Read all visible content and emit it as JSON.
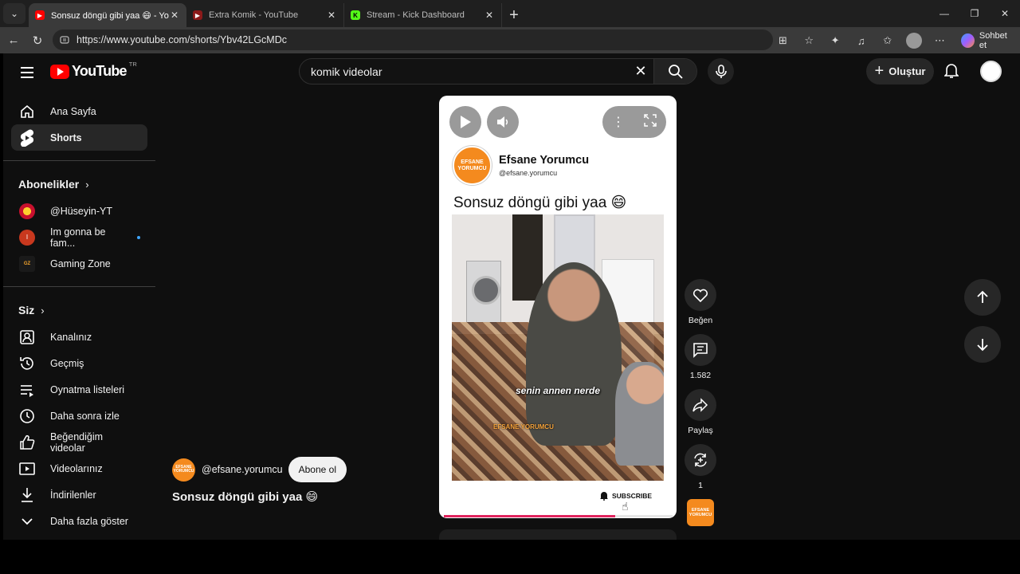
{
  "browser": {
    "tabs": [
      {
        "title": "Sonsuz döngü gibi yaa 😄 - YouTube",
        "active": true
      },
      {
        "title": "Extra Komik - YouTube",
        "active": false
      },
      {
        "title": "Stream - Kick Dashboard",
        "active": false
      }
    ],
    "url": "https://www.youtube.com/shorts/Ybv42LGcMDc",
    "chat_label": "Sohbet et"
  },
  "header": {
    "logo_text": "YouTube",
    "country_code": "TR",
    "search_value": "komik videolar",
    "create_label": "Oluştur"
  },
  "sidebar": {
    "main": [
      {
        "label": "Ana Sayfa",
        "icon": "home-icon"
      },
      {
        "label": "Shorts",
        "icon": "shorts-icon",
        "active": true
      }
    ],
    "subscriptions_title": "Abonelikler",
    "subscriptions": [
      {
        "label": "@Hüseyin-YT"
      },
      {
        "label": "Im gonna be fam...",
        "avatar_letter": "I",
        "new_dot": true
      },
      {
        "label": "Gaming Zone"
      }
    ],
    "you_title": "Siz",
    "you": [
      {
        "label": "Kanalınız",
        "icon": "channel-icon"
      },
      {
        "label": "Geçmiş",
        "icon": "history-icon"
      },
      {
        "label": "Oynatma listeleri",
        "icon": "playlists-icon"
      },
      {
        "label": "Daha sonra izle",
        "icon": "watch-later-icon"
      },
      {
        "label": "Beğendiğim videolar",
        "icon": "liked-icon"
      },
      {
        "label": "Videolarınız",
        "icon": "your-videos-icon"
      },
      {
        "label": "İndirilenler",
        "icon": "downloads-icon"
      },
      {
        "label": "Daha fazla göster",
        "icon": "chevron-down-icon"
      }
    ]
  },
  "short": {
    "channel_name": "Efsane Yorumcu",
    "channel_handle": "@efsane.yorumcu",
    "logo_text": "EFSANE YORUMCU",
    "title": "Sonsuz döngü gibi yaa 😄",
    "caption": "senin annen nerde",
    "watermark": "EFSANE YORUMCU",
    "subscribe_label": "SUBSCRIBE",
    "progress": 0.75
  },
  "actions": {
    "like_label": "Beğen",
    "comments_count": "1.582",
    "share_label": "Paylaş",
    "remix_count": "1"
  },
  "info": {
    "handle": "@efsane.yorumcu",
    "subscribe_label": "Abone ol",
    "title": "Sonsuz döngü gibi yaa 😄"
  },
  "colors": {
    "brand_red": "#ff0000",
    "progress": "#e0245e",
    "channel_orange": "#f48a1e"
  }
}
